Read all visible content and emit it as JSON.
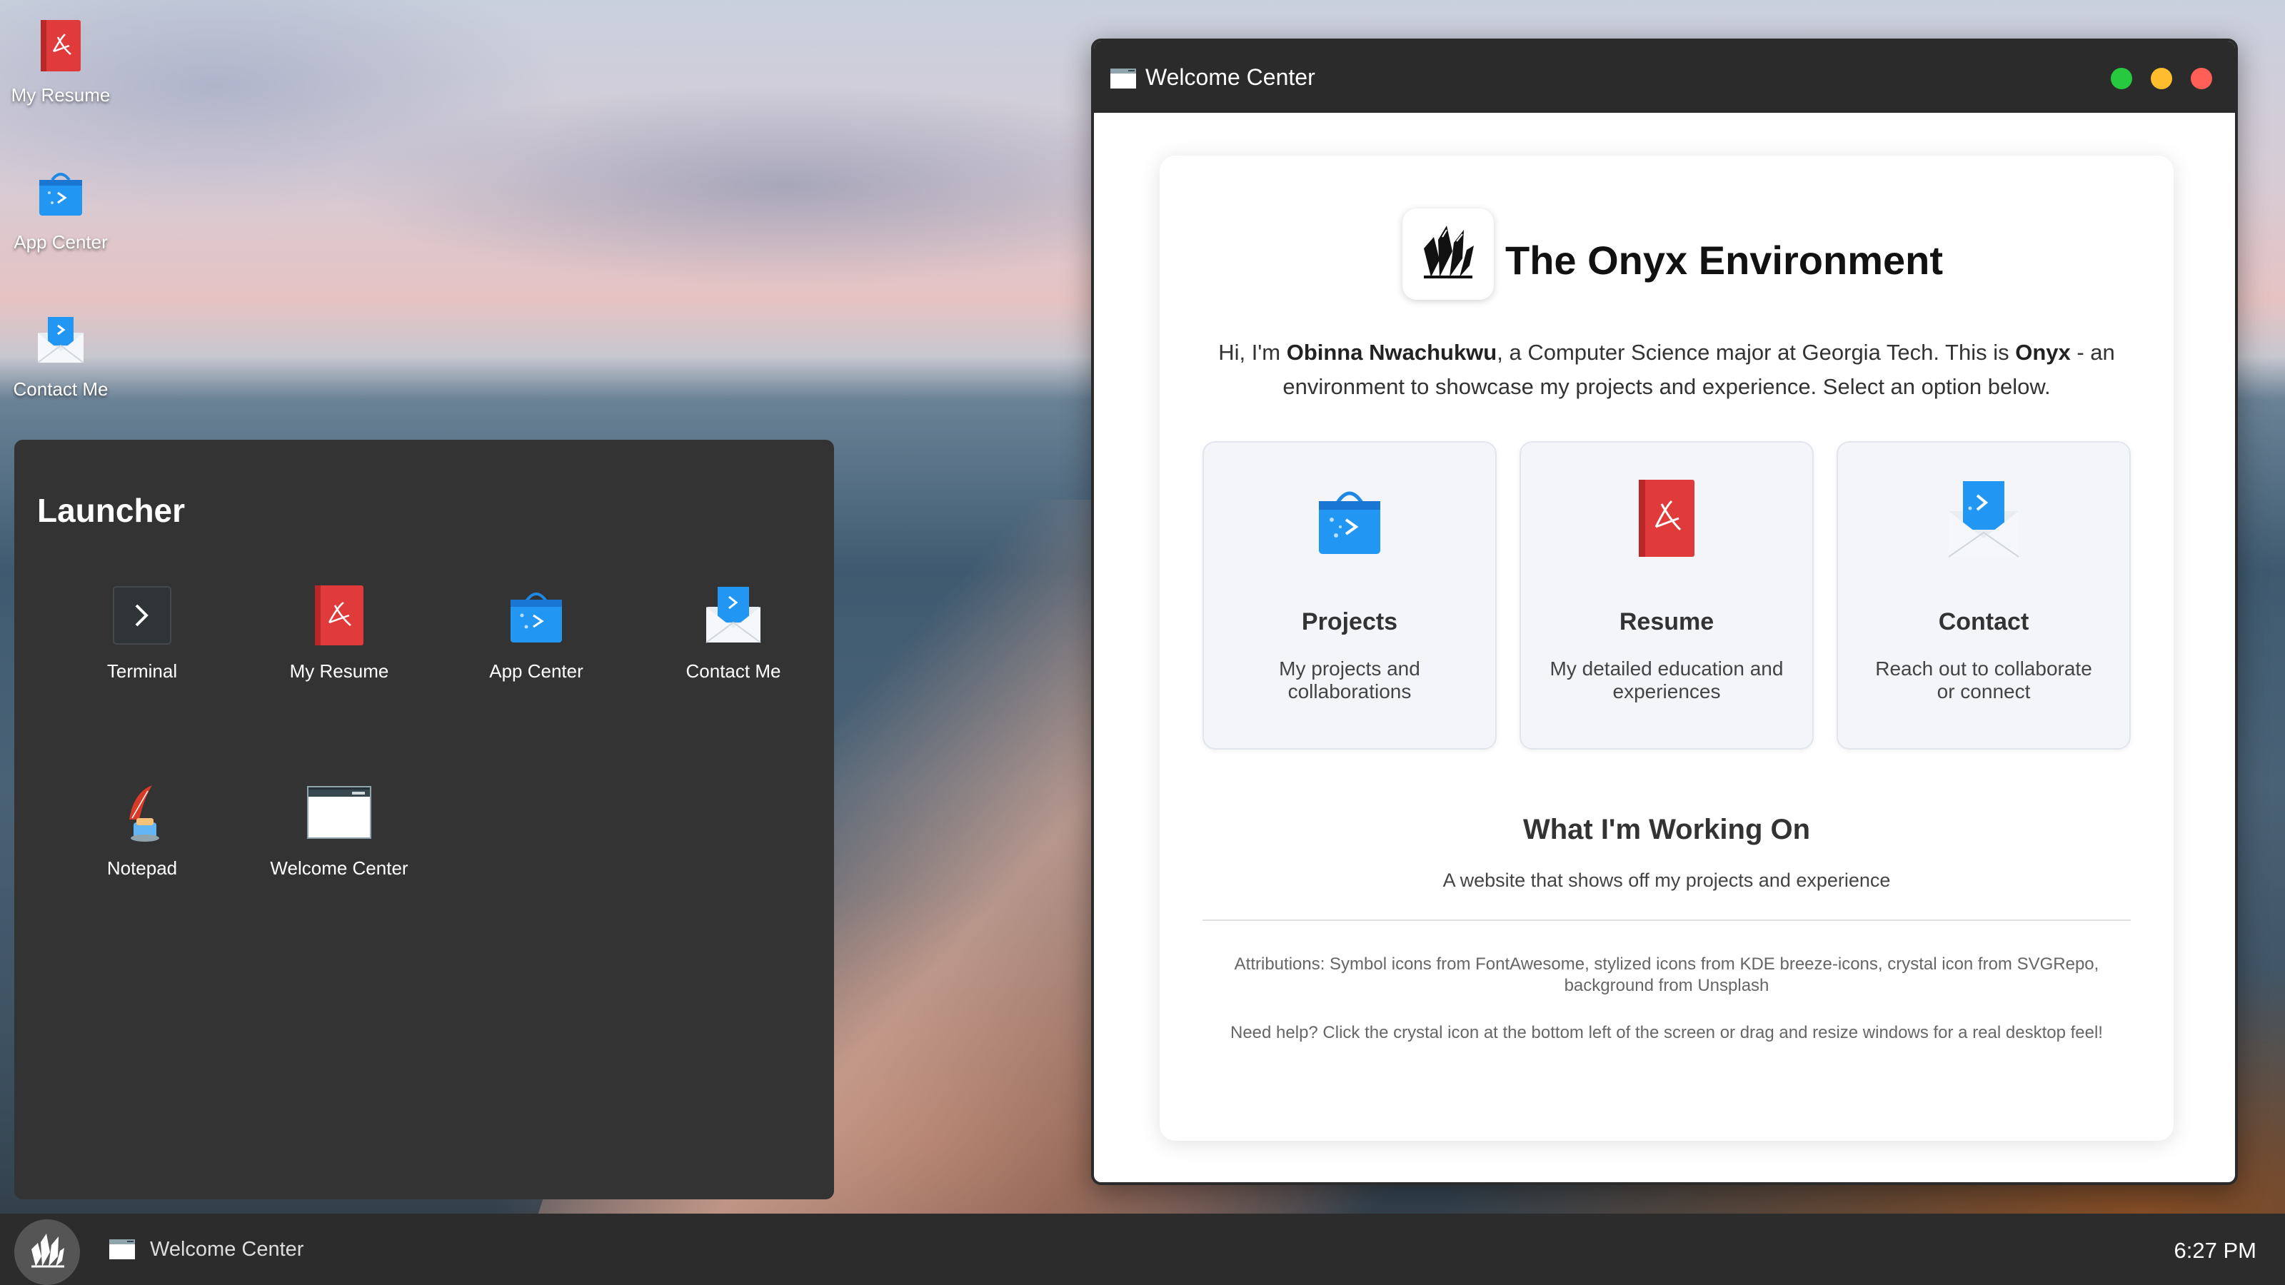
{
  "desktop": {
    "icons": [
      {
        "label": "My Resume",
        "icon": "pdf-icon"
      },
      {
        "label": "App Center",
        "icon": "app-store-icon"
      },
      {
        "label": "Contact Me",
        "icon": "mail-icon"
      }
    ]
  },
  "launcher": {
    "title": "Launcher",
    "items": [
      {
        "label": "Terminal",
        "icon": "terminal-icon"
      },
      {
        "label": "My Resume",
        "icon": "pdf-icon"
      },
      {
        "label": "App Center",
        "icon": "app-store-icon"
      },
      {
        "label": "Contact Me",
        "icon": "mail-icon"
      },
      {
        "label": "Notepad",
        "icon": "notepad-icon"
      },
      {
        "label": "Welcome Center",
        "icon": "window-icon"
      }
    ]
  },
  "window": {
    "title": "Welcome Center",
    "controls": {
      "maximize_color": "#27c93f",
      "minimize_color": "#ffbd2e",
      "close_color": "#ff5f56"
    },
    "hero_title": "The Onyx Environment",
    "intro": {
      "p1": "Hi, I'm ",
      "name": "Obinna Nwachukwu",
      "p2": ", a Computer Science major at Georgia Tech. This is ",
      "brand": "Onyx",
      "p3": " - an environment to showcase my projects and experience. Select an option below."
    },
    "options": [
      {
        "title": "Projects",
        "desc": "My projects and collaborations",
        "icon": "app-store-icon"
      },
      {
        "title": "Resume",
        "desc": "My detailed education and experiences",
        "icon": "pdf-icon"
      },
      {
        "title": "Contact",
        "desc": "Reach out to collaborate or connect",
        "icon": "mail-icon"
      }
    ],
    "working_title": "What I'm Working On",
    "working_desc": "A website that shows off my projects and experience",
    "attributions": "Attributions: Symbol icons from FontAwesome, stylized icons from KDE breeze-icons, crystal icon from SVGRepo, background from Unsplash",
    "help": "Need help? Click the crystal icon at the bottom left of the screen or drag and resize windows for a real desktop feel!"
  },
  "taskbar": {
    "task_label": "Welcome Center",
    "clock": "6:27 PM"
  }
}
